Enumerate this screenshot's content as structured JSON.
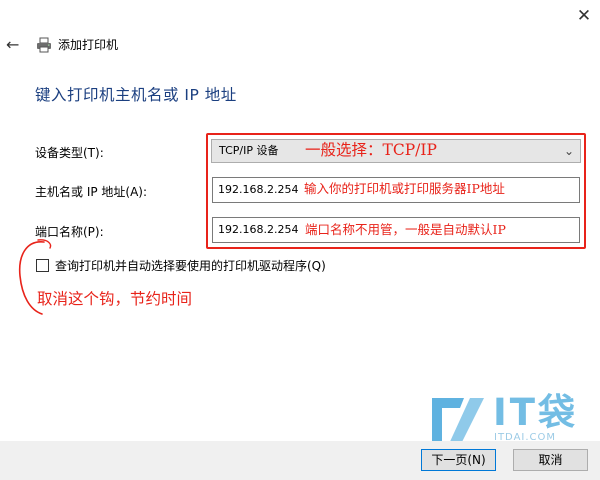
{
  "window": {
    "close_glyph": "✕",
    "back_glyph": "←",
    "title": "添加打印机"
  },
  "heading": "键入打印机主机名或 IP 地址",
  "form": {
    "device_type_label": "设备类型(T):",
    "device_type_value": "TCP/IP 设备",
    "hostname_label": "主机名或 IP 地址(A):",
    "hostname_value": "192.168.2.254",
    "port_label": "端口名称(P):",
    "port_value": "192.168.2.254",
    "query_checkbox_label": "查询打印机并自动选择要使用的打印机驱动程序(Q)",
    "query_checkbox_checked": false
  },
  "annotations": {
    "device_type_note": "一般选择：TCP/IP",
    "hostname_note": "输入你的打印机或打印服务器IP地址",
    "port_note": "端口名称不用管，一般是自动默认IP",
    "checkbox_note": "取消这个钩，节约时间",
    "color": "#e8231a"
  },
  "watermark": {
    "brand": "IT袋",
    "url": "ITDAI.COM"
  },
  "buttons": {
    "next": "下一页(N)",
    "cancel": "取消"
  },
  "colors": {
    "heading": "#1b3f80",
    "footer_bg": "#f0f0f0",
    "primary_button_border": "#0078d7",
    "watermark": "#73bde4"
  }
}
